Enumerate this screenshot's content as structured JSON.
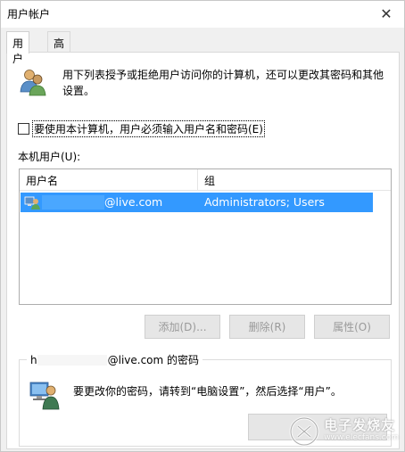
{
  "window": {
    "title": "用户帐户",
    "close_glyph": "✕"
  },
  "tabs": [
    {
      "label": "用户"
    },
    {
      "label": "高级"
    }
  ],
  "intro": {
    "text": "用下列表授予或拒绝用户访问你的计算机，还可以更改其密码和其他设置。"
  },
  "checkbox": {
    "label": "要使用本计算机，用户必须输入用户名和密码(E)",
    "checked": false
  },
  "users_section": {
    "label": "本机用户(U):"
  },
  "listview": {
    "columns": [
      "用户名",
      "组"
    ],
    "rows": [
      {
        "user": "@live.com",
        "group": "Administrators; Users",
        "selected": true,
        "icon": "user-icon"
      }
    ]
  },
  "buttons": {
    "add": "添加(D)...",
    "delete": "删除(R)",
    "properties": "属性(O)"
  },
  "password_box": {
    "title_prefix": "h",
    "title_suffix": "@live.com 的密码",
    "text": "要更改你的密码，请转到“电脑设置”，然后选择“用户”。",
    "icon": "user-key-icon"
  },
  "watermark": {
    "line1": "电子发烧友",
    "line2": "www.elecfans.com"
  },
  "colors": {
    "selection": "#3399ff",
    "window_bg": "#f0f0f0",
    "panel_bg": "#ffffff"
  }
}
